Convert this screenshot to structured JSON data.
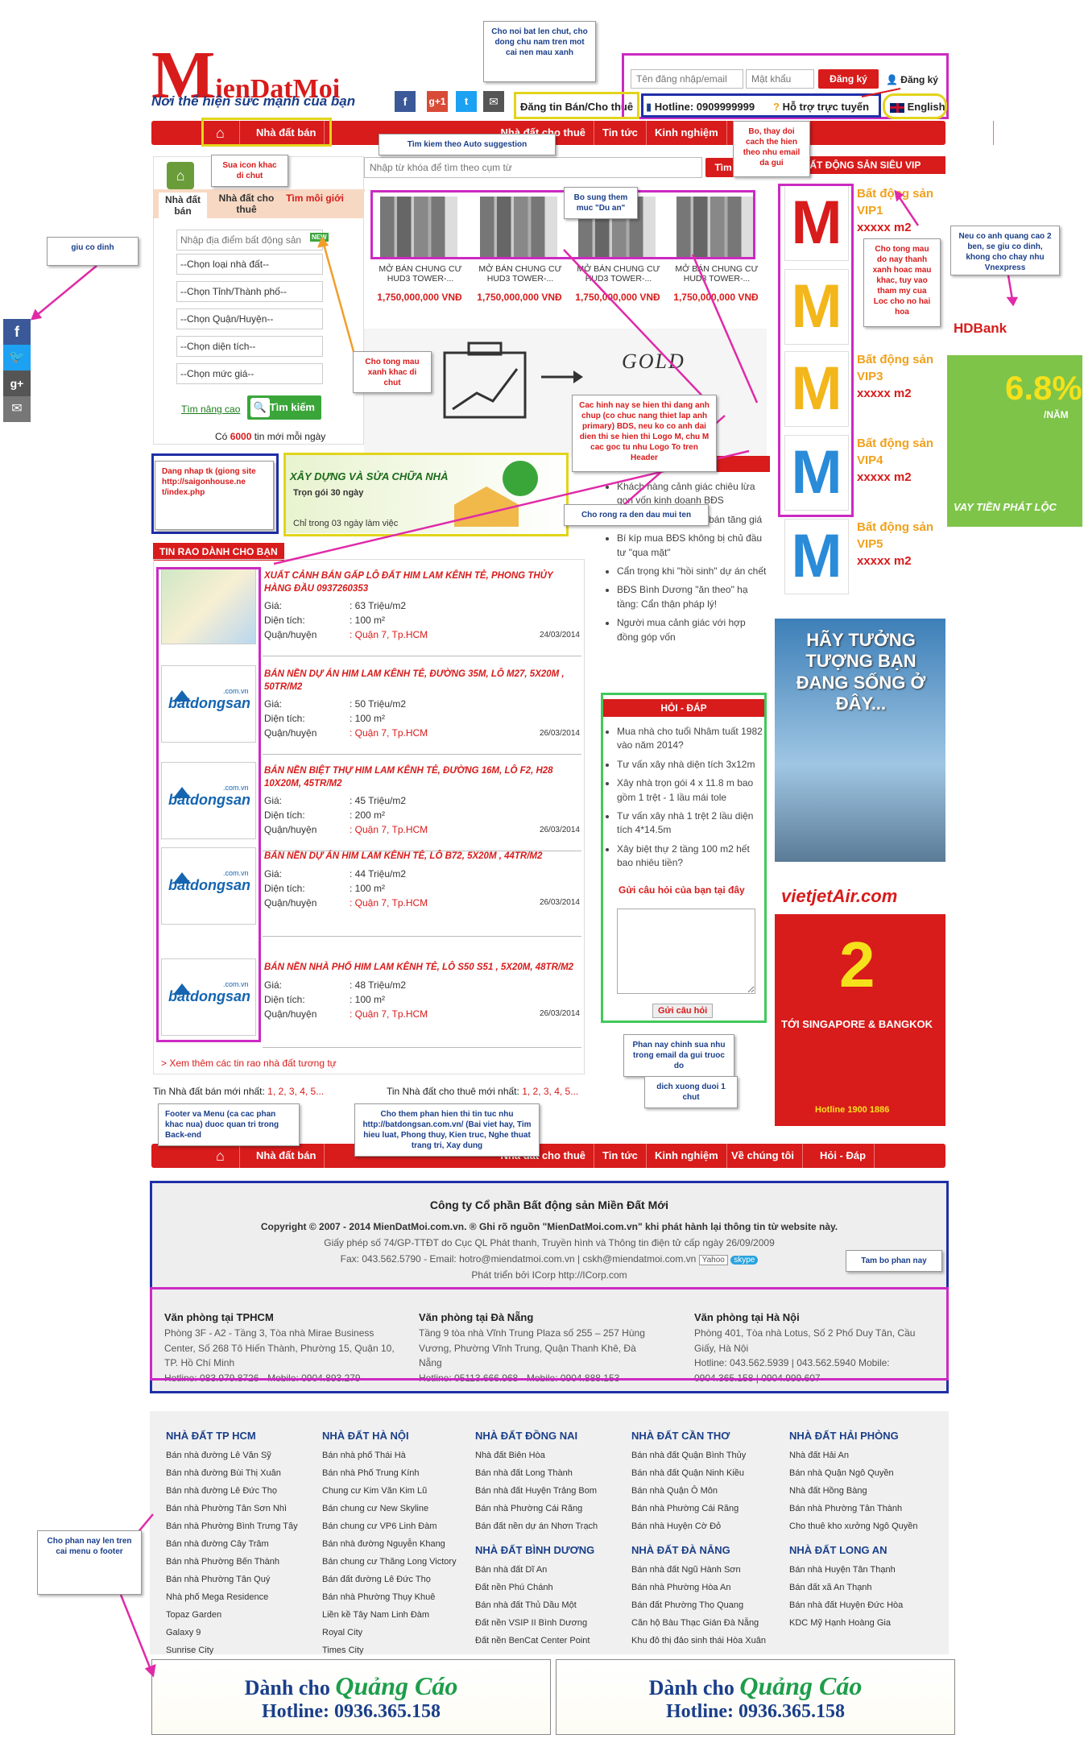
{
  "header": {
    "logo_m": "M",
    "logo_rest": "ienDatMoi",
    "slogan": "Nơi thể hiện sức mạnh của bạn",
    "username_placeholder": "Tên đăng nhập/email",
    "password_placeholder": "Mật khẩu",
    "login_button": "Đăng ký",
    "register_link": "Đăng ký",
    "post_button": "Đăng tin Bán/Cho thuê",
    "hotline": "Hotline: 0909999999",
    "support": "Hỗ trợ trực tuyến",
    "language": "English",
    "g_plus": "g+1"
  },
  "nav": {
    "items": [
      "Nhà đất bán",
      "Nhà đất cho thuê",
      "Tin tức",
      "Kinh nghiệm",
      "Hỏi - Đáp"
    ],
    "footer_items": [
      "Nhà đất bán",
      "Nhà đất cho thuê",
      "Tin tức",
      "Kinh nghiệm",
      "Về chúng tôi",
      "Hỏi - Đáp"
    ]
  },
  "search": {
    "tabs": [
      "Nhà đất bán",
      "Nhà đất cho thuê",
      "Tìm môi giới"
    ],
    "place_placeholder": "Nhập địa điểm bất động sản",
    "new_badge": "NEW",
    "selects": [
      "--Chọn loại nhà đất--",
      "--Chọn Tỉnh/Thành phố--",
      "--Chọn Quận/Huyện--",
      "--Chọn diện tích--",
      "--Chọn mức giá--"
    ],
    "advanced": "Tìm nâng cao",
    "search_button": "Tìm kiếm",
    "count_prefix": "Có ",
    "count": "6000",
    "count_suffix": " tin mới mỗi ngày",
    "keyword_placeholder": "Nhập từ khóa để tìm theo cụm từ",
    "keyword_button": "Tìm"
  },
  "projects": [
    {
      "title": "MỞ BÁN CHUNG CƯ HUD3 TOWER-...",
      "price": "1,750,000,000 VNĐ"
    },
    {
      "title": "MỞ BÁN CHUNG CƯ HUD3 TOWER-...",
      "price": "1,750,000,000 VNĐ"
    },
    {
      "title": "MỞ BÁN CHUNG CƯ HUD3 TOWER-...",
      "price": "1,750,000,000 VNĐ"
    },
    {
      "title": "MỞ BÁN CHUNG CƯ HUD3 TOWER-...",
      "price": "1,750,000,000 VNĐ"
    }
  ],
  "banner": {
    "word": "GOLD"
  },
  "ads_small": {
    "title": "XÂY DỰNG VÀ SỬA CHỮA NHÀ",
    "line1": "Trọn gói 30 ngày",
    "line2": "Chỉ trong 03 ngày làm việc"
  },
  "listing_title": "TIN RAO DÀNH CHO BẠN",
  "listings": [
    {
      "title": "XUẤT CẢNH BÁN GẤP LÔ ĐẤT HIM LAM KÊNH TẺ, PHONG THỦY HÀNG ĐẦU 0937260353",
      "price": ": 63 Triệu/m2",
      "area": ": 100 m²",
      "district": ": Quận 7, Tp.HCM",
      "date": "24/03/2014"
    },
    {
      "title": "BÁN NỀN DỰ ÁN HIM LAM KÊNH TẺ, ĐƯỜNG 35M, LÔ M27, 5X20M , 50TR/M2",
      "price": ": 50 Triệu/m2",
      "area": ": 100 m²",
      "district": ": Quận 7, Tp.HCM",
      "date": "26/03/2014"
    },
    {
      "title": "BÁN NỀN BIỆT THỰ HIM LAM KÊNH TẺ, ĐƯỜNG 16M, LÔ F2, H28 10X20M, 45TR/M2",
      "price": ": 45 Triệu/m2",
      "area": ": 200 m²",
      "district": ": Quận 7, Tp.HCM",
      "date": "26/03/2014"
    },
    {
      "title": "BÁN NỀN DỰ ÁN HIM LAM KÊNH TẺ, LÔ B72, 5X20M , 44TR/M2",
      "price": ": 44 Triệu/m2",
      "area": ": 100 m²",
      "district": ": Quận 7, Tp.HCM",
      "date": "26/03/2014"
    },
    {
      "title": "BÁN NỀN NHÀ PHỐ HIM LAM KÊNH TẺ, LÔ S50 S51 , 5X20M, 48TR/M2",
      "price": ": 48 Triệu/m2",
      "area": ": 100 m²",
      "district": ": Quận 7, Tp.HCM",
      "date": "26/03/2014"
    }
  ],
  "listing_labels": {
    "price": "Giá:",
    "area": "Diện tích:",
    "district": "Quận/huyện"
  },
  "more_link": "> Xem thêm các tin rao nhà đất tương tự",
  "pagers": {
    "sell": "Tin Nhà đất bán mới nhất: ",
    "rent": "Tin Nhà đất cho thuê mới nhất: ",
    "pages": "1, 2, 3, 4, 5..."
  },
  "bds_logo": {
    "text": "batdongsan",
    ".com.vn": ".com.vn"
  },
  "news": [
    "Khách hàng cảnh giác chiêu lừa gọn vốn kinh doanh BĐS",
    "Đất nền vùng ven dễ bán tăng giá",
    "Bí kíp mua BĐS không bị chủ đầu tư \"qua mặt\"",
    "Cẩn trọng khi \"hồi sinh\" dự án chết",
    "BĐS Bình Dương \"ăn theo\" hạ tầng: Cẩn thận pháp lý!",
    "Người mua cảnh giác với hợp đồng góp vốn"
  ],
  "faq": {
    "title": "HỎI - ĐÁP",
    "items": [
      "Mua nhà cho tuổi Nhâm tuất 1982 vào năm 2014?",
      "Tư vấn xây nhà diện tích 3x12m",
      "Xây nhà trọn gói 4 x 11.8 m bao gồm 1 trệt - 1 lầu mái tole",
      "Tư vấn xây nhà 1 trệt 2 lầu diện tích 4*14.5m",
      "Xây biệt thự 2 tầng 100 m2 hết bao nhiêu tiền?"
    ],
    "ask_link": "Gửi câu hỏi của bạn tại đây",
    "submit": "Gửi câu hỏi"
  },
  "vip": {
    "title": "BẤT ĐỘNG SẢN SIÊU VIP",
    "items": [
      {
        "name": "Bất động sản VIP1",
        "sub": "xxxxx m2",
        "color": "#d81b1b"
      },
      {
        "name": "Bất động sản VIP3",
        "sub": "xxxxx m2",
        "color": "#f3b61b"
      },
      {
        "name": "Bất động sản VIP4",
        "sub": "xxxxx m2",
        "color": "#2a8bd8"
      },
      {
        "name": "Bất động sản VIP5",
        "sub": "xxxxx m2",
        "color": "#2a8bd8"
      }
    ]
  },
  "right_ads": {
    "hdbank": "HDBank",
    "hdbank_rate": "6.8%",
    "hdbank_unit": "/NĂM",
    "hdbank_cta": "VAY TIỀN PHÁT LỘC",
    "placeholder": "HÃY TƯỞNG TƯỢNG BẠN ĐANG SỐNG Ở ĐÂY...",
    "vj": "vietjetAir.com",
    "vj_num": "2",
    "vj_route": "TỚI SINGAPORE & BANGKOK",
    "vj_hot": "Hotline 1900 1886"
  },
  "footer": {
    "company": "Công ty Cổ phần Bất động sản Miền Đất Mới",
    "copyright": "Copyright © 2007 - 2014 MienDatMoi.com.vn. ® Ghi rõ nguồn \"MienDatMoi.com.vn\" khi phát hành lại thông tin từ website này.",
    "license": "Giấy phép số 74/GP-TTĐT do Cục QL Phát thanh, Truyền hình và Thông tin điện tử cấp ngày 26/09/2009",
    "contact": "Fax: 043.562.5790 - Email: hotro@miendatmoi.com.vn | cskh@miendatmoi.com.vn",
    "yahoo": "Yahoo",
    "skype": "skype",
    "dev": "Phát triển bởi ICorp http://ICorp.com",
    "offices": [
      {
        "name": "Văn phòng tại TPHCM",
        "addr": "Phòng 3F - A2 - Tầng 3, Tòa nhà Mirae Business Center, Số 268 Tô Hiến Thành, Phường 15, Quận 10, TP. Hồ Chí Minh",
        "phone": "Hotline: 083.979.8726 - Mobile: 0904.893.279"
      },
      {
        "name": "Văn phòng tại Đà Nẵng",
        "addr": "Tầng 9 tòa nhà Vĩnh Trung Plaza số 255 – 257 Hùng Vương, Phường Vĩnh Trung, Quận Thanh Khê, Đà Nẵng",
        "phone": "Hotline: 05113.666.968 - Mobile: 0904.888.153"
      },
      {
        "name": "Văn phòng tại Hà Nội",
        "addr": "Phòng 401, Tòa nhà Lotus, Số 2 Phố Duy Tân, Cầu Giấy, Hà Nội",
        "phone": "Hotline: 043.562.5939 | 043.562.5940 Mobile: 0904.365.158 | 0904.999.607"
      }
    ]
  },
  "link_columns": [
    {
      "title": "NHÀ ĐẤT TP HCM",
      "links": [
        "Bán nhà đường Lê Văn Sỹ",
        "Bán nhà đường Bùi Thị Xuân",
        "Bán nhà đường Lê Đức Thọ",
        "Bán nhà Phường Tân Sơn Nhì",
        "Bán nhà Phường Bình Trưng Tây",
        "Bán nhà đường Cây Trâm",
        "Bán nhà Phường Bến Thành",
        "Bán nhà Phường Tân Quý",
        "Nhà phố Mega Residence",
        "Topaz Garden",
        "Galaxy 9",
        "Sunrise City"
      ]
    },
    {
      "title": "NHÀ ĐẤT HÀ NỘI",
      "links": [
        "Bán nhà phố Thái Hà",
        "Bán nhà Phố Trung Kính",
        "Chung cư Kim Văn Kim Lũ",
        "Bán chung cư New Skyline",
        "Bán chung cư VP6 Linh Đàm",
        "Bán nhà đường Nguyễn Khang",
        "Bán chung cư Thăng Long Victory",
        "Bán đất đường Lê Đức Thọ",
        "Bán nhà Phường Thụy Khuê",
        "Liền kề Tây Nam Linh Đàm",
        "Royal City",
        "Times City"
      ]
    },
    {
      "title": "NHÀ ĐẤT ĐỒNG NAI",
      "links": [
        "Nhà đất Biên Hòa",
        "Bán nhà đất Long Thành",
        "Bán nhà đất Huyện Trảng Bom",
        "Bán nhà Phường Cái Răng",
        "Bán đất nền dự án Nhơn Trạch"
      ]
    },
    {
      "title": "NHÀ ĐẤT CẦN THƠ",
      "links": [
        "Bán nhà đất Quận Bình Thủy",
        "Bán nhà đất Quận Ninh Kiều",
        "Bán nhà Quận Ô Môn",
        "Bán nhà Phường Cái Răng",
        "Bán nhà Huyện Cờ Đỏ"
      ]
    },
    {
      "title": "NHÀ ĐẤT HẢI PHÒNG",
      "links": [
        "Nhà đất Hải An",
        "Bán nhà Quận Ngô Quyền",
        "Nhà đất Hồng Bàng",
        "Bán nhà Phường Tân Thành",
        "Cho thuê kho xưởng Ngô Quyền"
      ]
    },
    {
      "title": "NHÀ ĐẤT BÌNH DƯƠNG",
      "links": [
        "Bán nhà đất Dĩ An",
        "Đất nền Phú Chánh",
        "Bán nhà đất Thủ Dầu Một",
        "Đất nền VSIP II Bình Dương",
        "Đất nền BenCat Center Point"
      ]
    },
    {
      "title": "NHÀ ĐẤT ĐÀ NẴNG",
      "links": [
        "Bán nhà đất Ngũ Hành Sơn",
        "Bán nhà Phường Hòa An",
        "Bán đất Phường Thọ Quang",
        "Căn hộ Bàu Thạc Gián Đà Nẵng",
        "Khu đô thị đảo sinh thái Hòa Xuân"
      ]
    },
    {
      "title": "NHÀ ĐẤT LONG AN",
      "links": [
        "Bán nhà Huyện Tân Thạnh",
        "Bán đất xã An Thạnh",
        "Bán nhà đất Huyện Đức Hòa",
        "KDC Mỹ Hạnh Hoàng Gia"
      ]
    }
  ],
  "bottom_ads": [
    {
      "line1": "Dành cho ",
      "line1b": "Quảng Cáo",
      "line2": "Hotline: 0936.365.158"
    },
    {
      "line1": "Dành cho ",
      "line1b": "Quảng Cáo",
      "line2": "Hotline: 0936.365.158"
    }
  ],
  "notes": {
    "n1": "Cho noi bat len chut, cho dong chu nam tren mot cai nen mau xanh",
    "n2": "Tìm kiem theo Auto suggestion",
    "n3": "Sua icon khac di chut",
    "n4": "Bo sung them muc \"Du an\"",
    "n5": "Bo, thay doi cach the hien theo nhu email da gui",
    "n6": "Cho tong mau do nay thanh xanh hoac mau khac, tuy vao tham my cua Loc cho no hai hoa",
    "n7": "Neu co anh quang cao 2 ben, se giu co dinh, khong cho chay nhu Vnexpress",
    "n8": "giu co dinh",
    "n9": "Cho tong mau xanh khac di chut",
    "n10": "Cac hinh nay se hien thi dang anh chup (co chuc nang thiet lap anh primary) BDS, neu ko co anh dai dien thi se hien thi Logo M, chu M cac goc tu nhu Logo To tren Header",
    "n11": "Dang nhap tk (giong site http://saigonhouse.ne t/index.php",
    "n12": "Cho rong ra den dau mui ten",
    "n13": "Phan nay chinh sua nhu trong email da gui truoc do",
    "n14": "dich xuong duoi 1 chut",
    "n15": "Footer va Menu (ca cac phan khac nua) duoc quan tri trong Back-end",
    "n16": "Cho them phan hien thi tin tuc nhu http://batdongsan.com.vn/ (Bai viet hay, Tim hieu luat, Phong thuy, Kien truc, Nghe thuat trang tri, Xay dung",
    "n17": "Tam bo phan nay",
    "n18": "Cho phan nay len tren cai menu o footer"
  }
}
